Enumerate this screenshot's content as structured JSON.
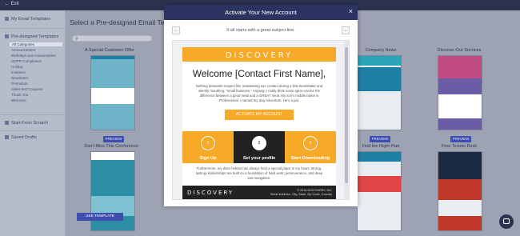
{
  "topbar": {
    "exit_label": "← Exit",
    "app_title": ""
  },
  "sidebar": {
    "my_email_templates": "My Email Templates",
    "predesigned_templates": "Pre-designed Templates",
    "categories": [
      "All Categories",
      "Announcement",
      "Birthdays and Anniversaries",
      "GDPR Compliance",
      "Holiday",
      "Invitation",
      "Newsletter",
      "Promotion",
      "Sales and Coupons",
      "Thank You",
      "Welcome"
    ],
    "start_from_scratch": "Start From Scratch",
    "saved_drafts": "Saved Drafts"
  },
  "main": {
    "title": "Select a Pre-designed Email Templa",
    "search_placeholder": "",
    "cards": [
      {
        "title": "A Special Customer Offer",
        "preview": "PREVIEW"
      },
      {
        "title": "Company News",
        "preview": "PREVIEW"
      },
      {
        "title": "Discover Our Services",
        "preview": "PREVIEW"
      },
      {
        "title": "Don't Miss This Conference",
        "preview": ""
      },
      {
        "title": "Find the Right Plan",
        "preview": ""
      },
      {
        "title": "Free Tickets Rock",
        "preview": ""
      }
    ]
  },
  "modal": {
    "title": "Activate Your New Account",
    "close_symbol": "×",
    "subject_line": "It all starts with a great subject line.",
    "nav_prev": "←",
    "nav_next": "→",
    "use_template": "USE TEMPLATE"
  },
  "email": {
    "logo": "DISCOVERY",
    "welcome": "Welcome [Contact First Name],",
    "body1": "Nothing demands respect like maintaining eye contact during a first handshake and silently mouthing, \"small business.\" Anyway, I really think some spice can be the difference between a good meal and a GREAT meal. My son's middle name is Professional. I named my dog Adventure. He's a pal.",
    "cta": "ACTIVATE MY ACCOUNT",
    "steps": [
      {
        "number": "1",
        "label": "Sign Up"
      },
      {
        "number": "2",
        "label": "Set your profile"
      },
      {
        "number": "3",
        "label": "Start Downloading"
      }
    ],
    "body2": "Furthermore, my diver helmet has always held a special place in my heart. Strong, lasting relationships are built on a foundation of hard work, perseverance, and deep sea navigation.",
    "footer_logo": "DISCOVERY",
    "footer_copyright": "© 2016 DISCOVERY, INC",
    "footer_address": "Street Address, City, State, Zip Code, Country"
  },
  "colors": {
    "accent_orange": "#f7a928",
    "navy": "#2b3360",
    "button_blue": "#3f4fb0"
  }
}
